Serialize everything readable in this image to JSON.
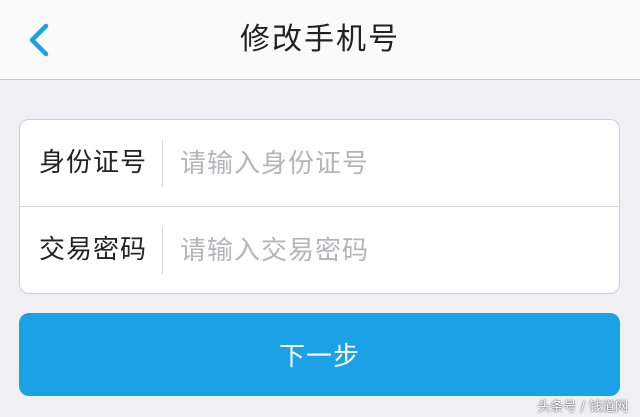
{
  "nav": {
    "title": "修改手机号",
    "back_icon": "chevron-left-icon",
    "accent_color": "#1aa1e6"
  },
  "form": {
    "fields": [
      {
        "label": "身份证号",
        "placeholder": "请输入身份证号",
        "value": ""
      },
      {
        "label": "交易密码",
        "placeholder": "请输入交易密码",
        "value": ""
      }
    ]
  },
  "actions": {
    "next_label": "下一步",
    "next_color": "#1aa1e6"
  },
  "watermark": {
    "text": "头条号 / 钱道网"
  }
}
